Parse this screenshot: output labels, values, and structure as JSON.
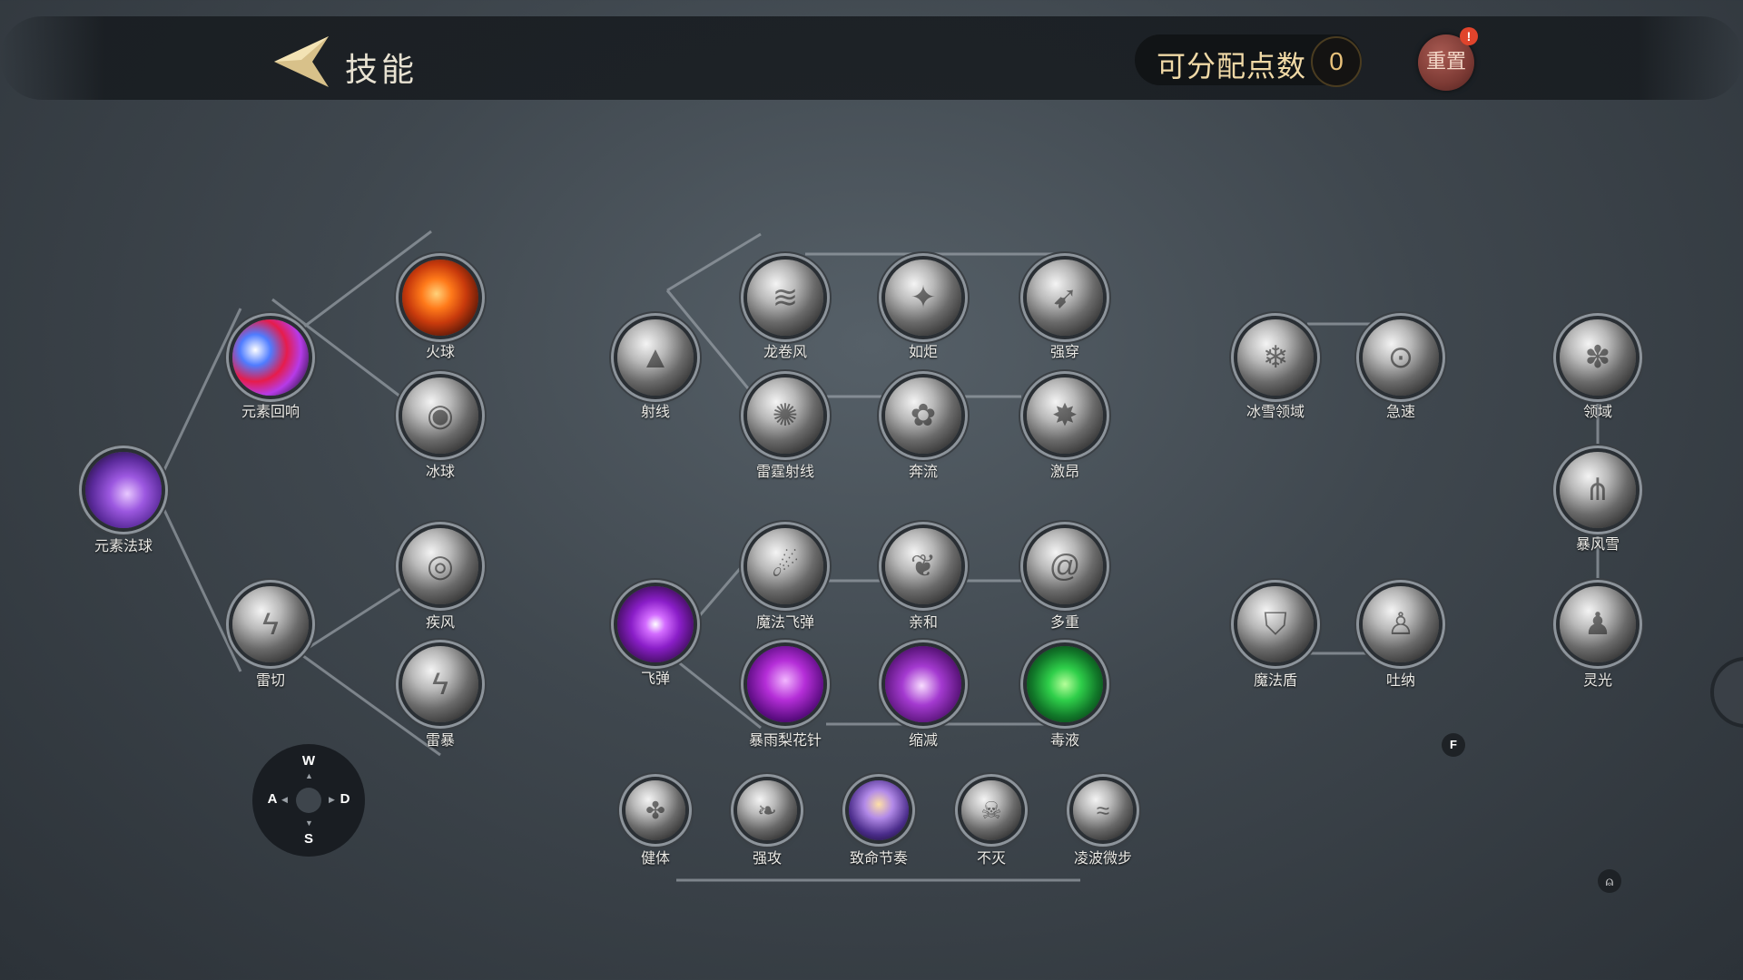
{
  "header": {
    "title": "技能",
    "points_label": "可分配点数",
    "points_value": "0",
    "reset_label": "重置",
    "reset_badge": "!"
  },
  "skills": {
    "elemental_orb": "元素法球",
    "elemental_echo": "元素回响",
    "fireball": "火球",
    "iceball": "冰球",
    "thunder_cut": "雷切",
    "gale": "疾风",
    "thunderstorm": "雷暴",
    "ray": "射线",
    "tornado": "龙卷风",
    "like_torch": "如炬",
    "strong_pierce": "强穿",
    "thunder_ray": "雷霆射线",
    "torrent": "奔流",
    "excite": "激昂",
    "missile": "飞弹",
    "magic_missile": "魔法飞弹",
    "affinity": "亲和",
    "multiple": "多重",
    "rain_needles": "暴雨梨花针",
    "shrink": "缩减",
    "venom": "毒液",
    "ice_domain": "冰雪领域",
    "haste": "急速",
    "magic_shield": "魔法盾",
    "breathe": "吐纳",
    "domain": "领域",
    "blizzard": "暴风雪",
    "aura": "灵光",
    "healthy_body": "健体",
    "strong_attack": "强攻",
    "deadly_rhythm": "致命节奏",
    "immortal": "不灭",
    "light_step": "凌波微步"
  },
  "controls": {
    "up": "W",
    "left": "A",
    "right": "D",
    "down": "S",
    "interact": "F"
  },
  "icons": {
    "back": "back-arrow-icon",
    "mouse": "mouse-icon"
  },
  "colors": {
    "accent_gold": "#e8c17a",
    "reset_red": "#7c3a34",
    "line": "#9aa1a8"
  }
}
